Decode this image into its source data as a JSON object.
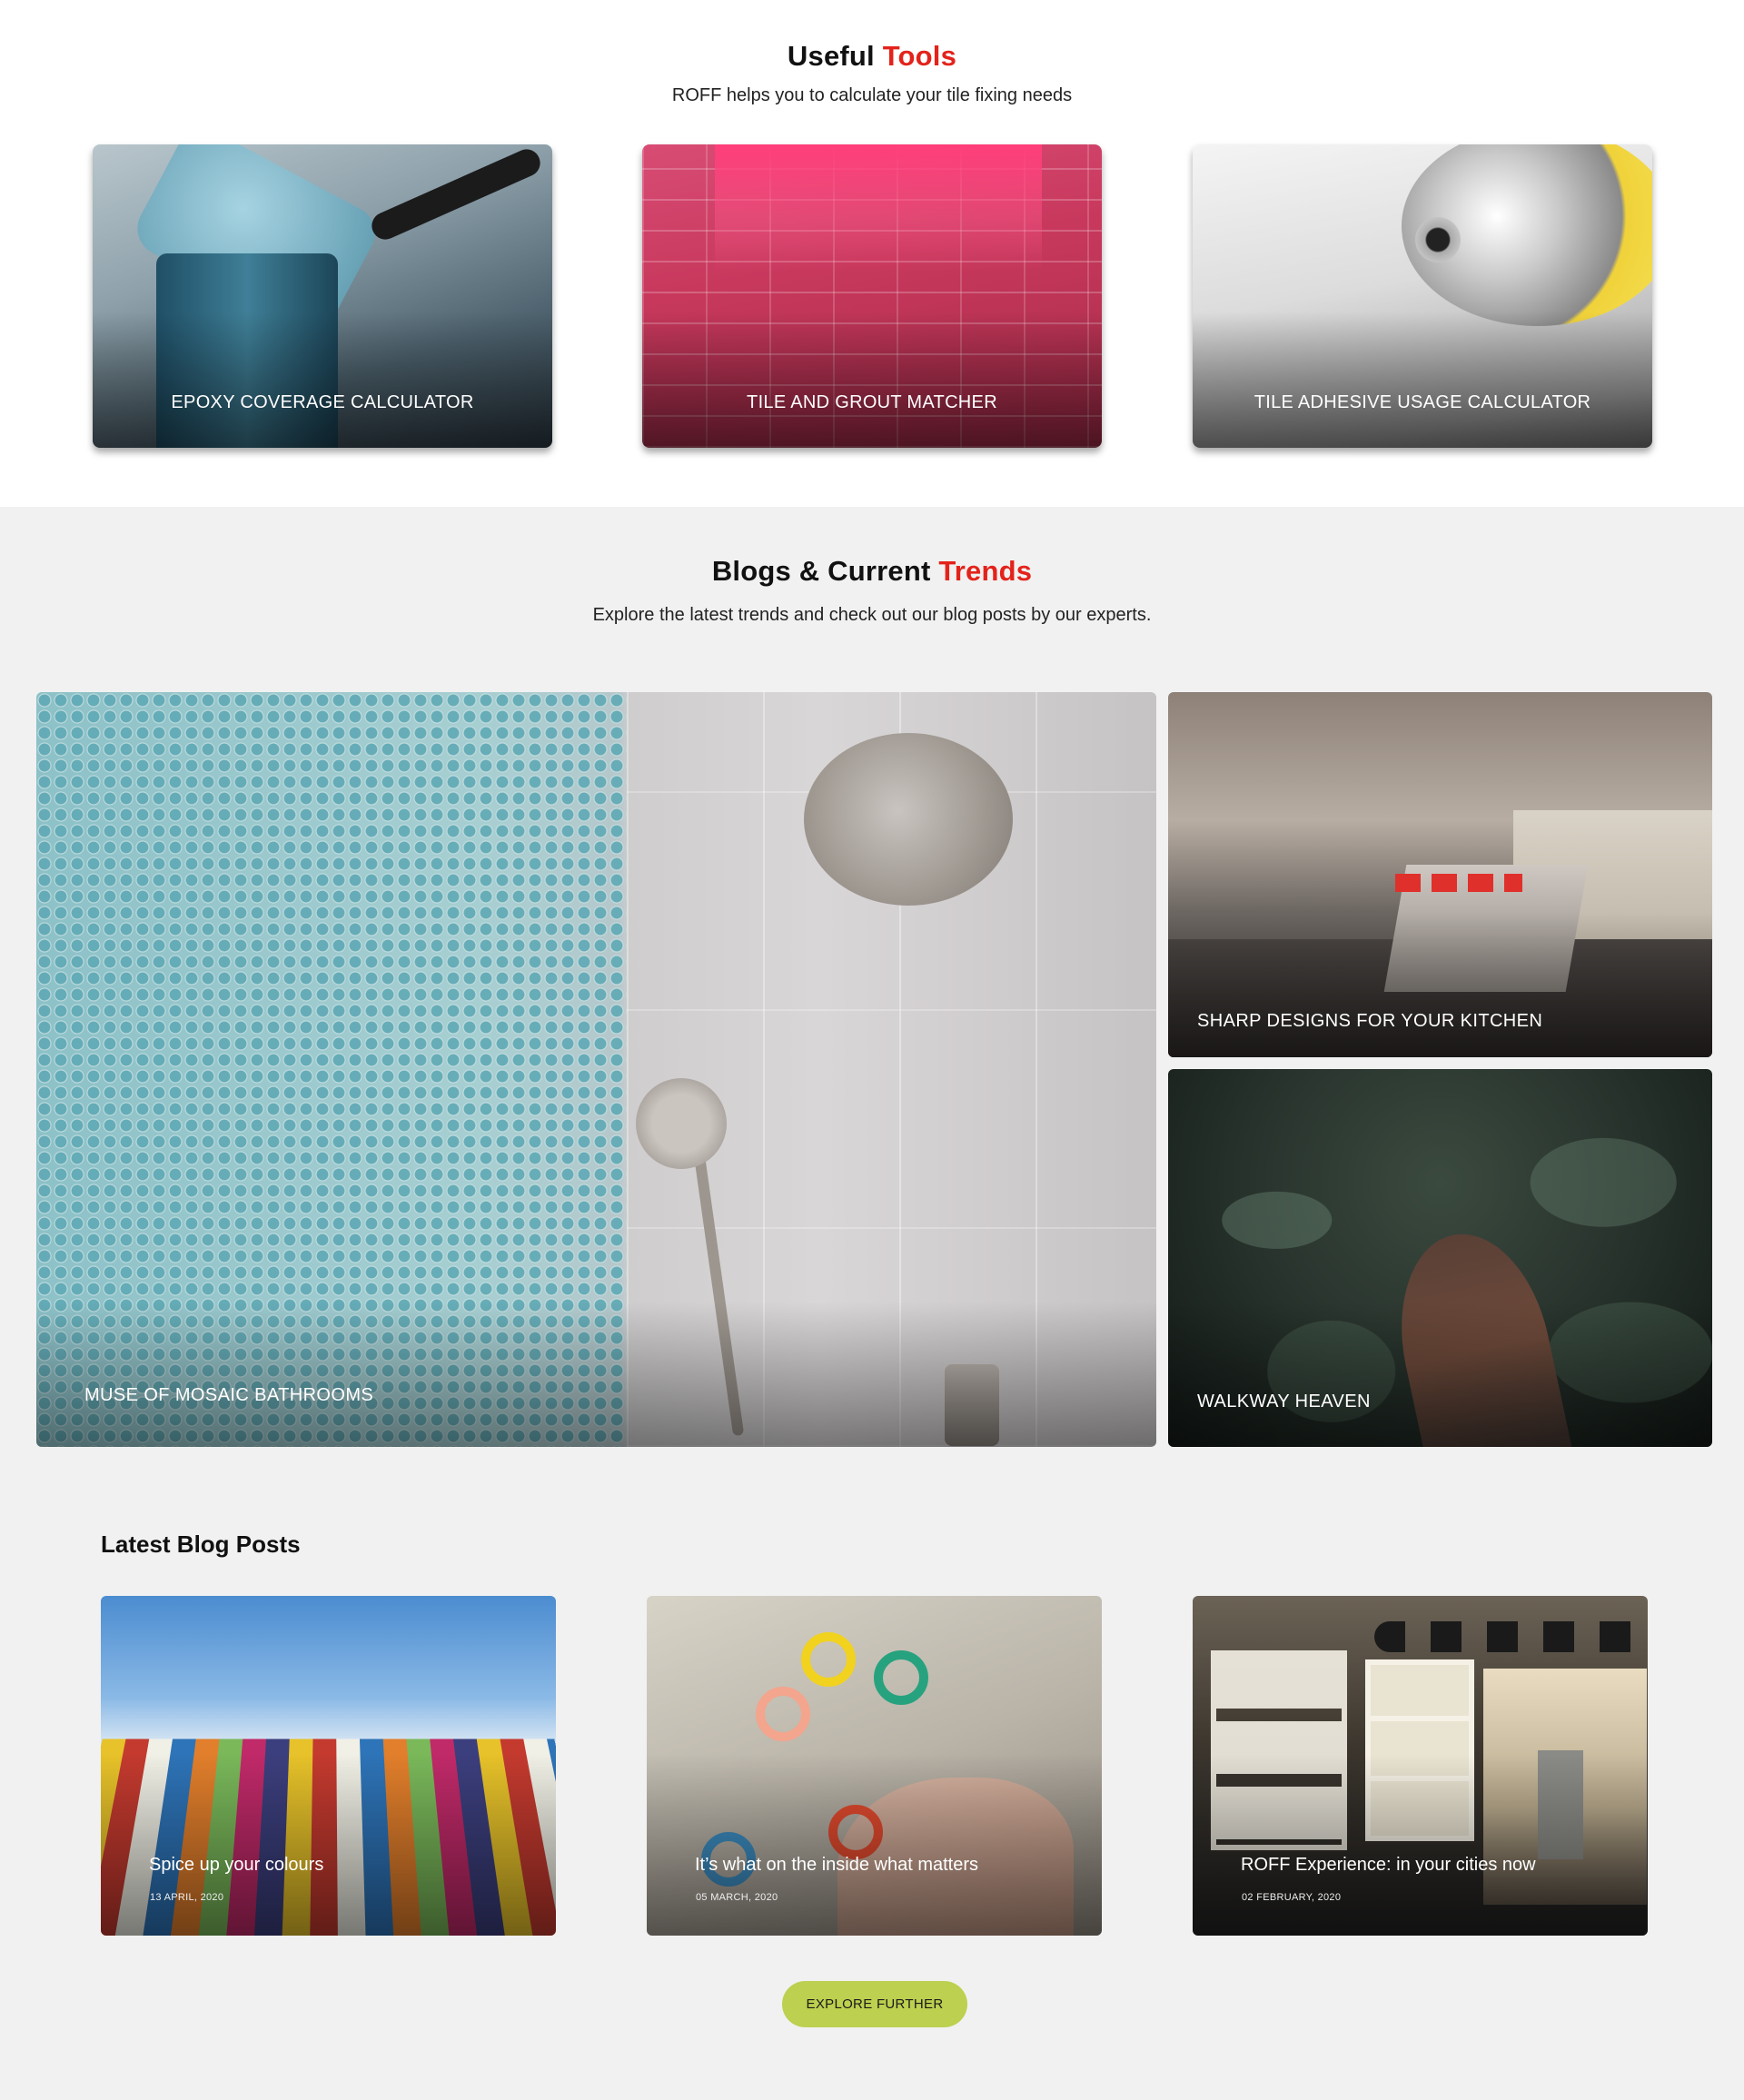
{
  "tools": {
    "title_main": "Useful",
    "title_accent": "Tools",
    "subtitle": "ROFF helps you to calculate your tile fixing needs",
    "cards": [
      {
        "label": "EPOXY COVERAGE CALCULATOR"
      },
      {
        "label": "TILE AND GROUT MATCHER"
      },
      {
        "label": "TILE ADHESIVE USAGE CALCULATOR"
      }
    ]
  },
  "trends": {
    "title_main": "Blogs & Current",
    "title_accent": "Trends",
    "subtitle": "Explore the latest trends and check out our blog posts by our experts.",
    "items": [
      {
        "label": "MUSE OF MOSAIC BATHROOMS"
      },
      {
        "label": "SHARP DESIGNS FOR YOUR KITCHEN"
      },
      {
        "label": "WALKWAY HEAVEN"
      }
    ]
  },
  "latest": {
    "title": "Latest Blog Posts",
    "posts": [
      {
        "title": "Spice up your colours",
        "date": "13 APRIL, 2020"
      },
      {
        "title": "It’s what on the inside what matters",
        "date": "05 MARCH, 2020"
      },
      {
        "title": "ROFF Experience: in your cities now",
        "date": "02 FEBRUARY, 2020"
      }
    ]
  },
  "explore_button": "EXPLORE FURTHER",
  "colors": {
    "accent_red": "#e3231b",
    "button_green": "#bdd04f",
    "section_gray": "#f1f1f1"
  }
}
